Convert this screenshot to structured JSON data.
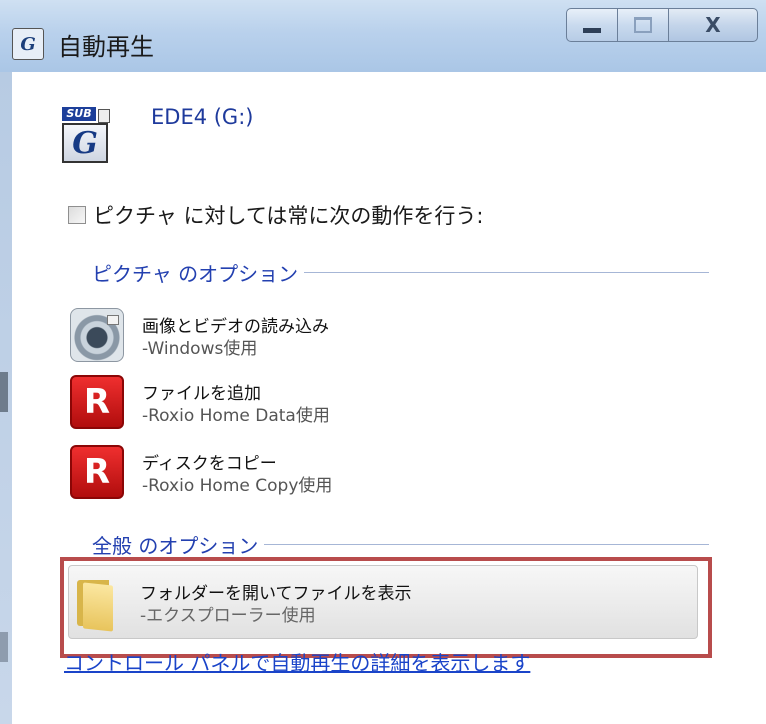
{
  "window": {
    "title": "自動再生",
    "minimize_icon": "minimize-icon",
    "maximize_icon": "maximize-icon",
    "close_label": "X"
  },
  "device": {
    "name": "EDE4 (G:)",
    "icon": "drive-icon",
    "icon_badge": "SUB",
    "icon_letter": "G"
  },
  "always": {
    "label": "ピクチャ に対しては常に次の動作を行う:",
    "checked": false
  },
  "picture_options": {
    "header": "ピクチャ のオプション",
    "items": [
      {
        "name": "画像とビデオの読み込み",
        "sub": "-Windows使用",
        "icon": "camera-icon"
      },
      {
        "name": "ファイルを追加",
        "sub": "-Roxio Home Data使用",
        "icon": "roxio-icon",
        "glyph": "R"
      },
      {
        "name": "ディスクをコピー",
        "sub": "-Roxio Home Copy使用",
        "icon": "roxio-icon",
        "glyph": "R"
      }
    ]
  },
  "general_options": {
    "header": "全般 のオプション",
    "items": [
      {
        "name": "フォルダーを開いてファイルを表示",
        "sub": "-エクスプローラー使用",
        "icon": "folder-icon"
      }
    ]
  },
  "footer": {
    "link": "コントロール パネルで自動再生の詳細を表示します"
  },
  "colors": {
    "highlight_border": "#b84c4c",
    "link": "#1a44c9",
    "section_header": "#2340b0"
  }
}
